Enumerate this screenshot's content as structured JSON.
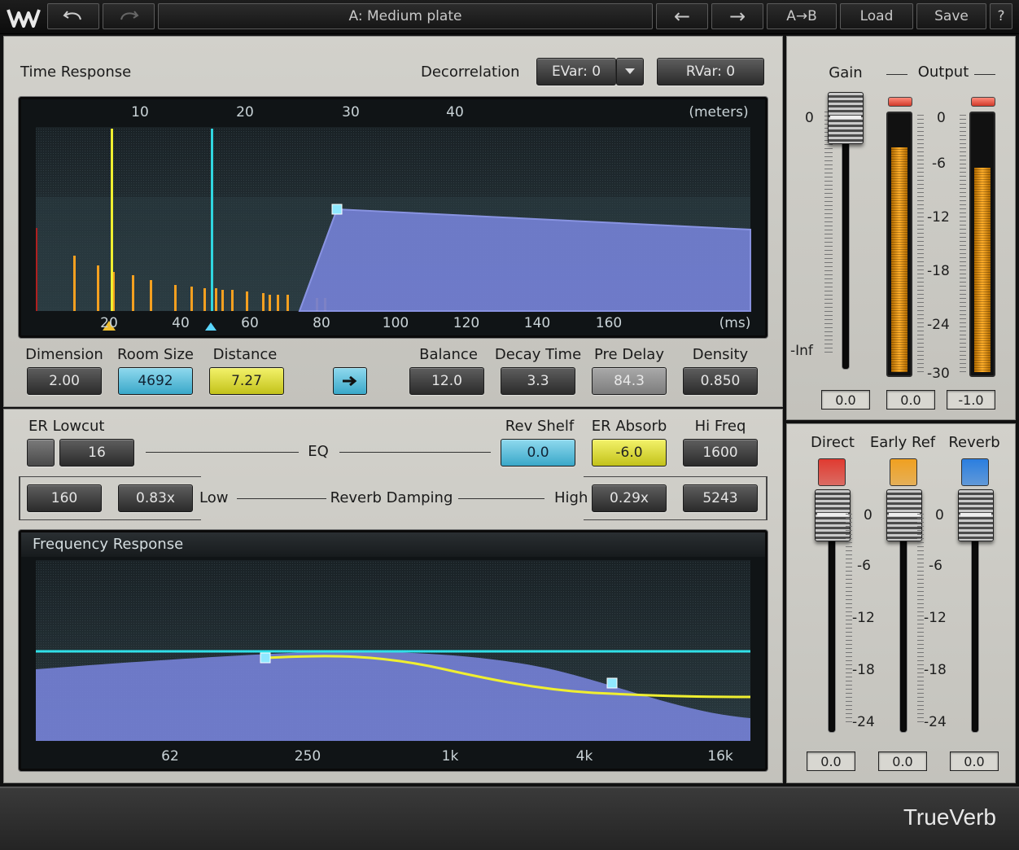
{
  "toolbar": {
    "preset": "A: Medium plate",
    "prev_label": "←",
    "next_label": "→",
    "ab_label": "A→B",
    "load_label": "Load",
    "save_label": "Save",
    "help_label": "?"
  },
  "time_response": {
    "title": "Time Response",
    "decorrelation_label": "Decorrelation",
    "evar": "EVar: 0",
    "rvar": "RVar: 0",
    "meters_ticks": [
      "10",
      "20",
      "30",
      "40"
    ],
    "meters_unit": "(meters)",
    "ms_ticks": [
      "20",
      "40",
      "60",
      "80",
      "100",
      "120",
      "140",
      "160"
    ],
    "ms_unit": "(ms)"
  },
  "params": {
    "dimension": {
      "label": "Dimension",
      "value": "2.00"
    },
    "room_size": {
      "label": "Room Size",
      "value": "4692"
    },
    "distance": {
      "label": "Distance",
      "value": "7.27"
    },
    "balance": {
      "label": "Balance",
      "value": "12.0"
    },
    "decay_time": {
      "label": "Decay Time",
      "value": "3.3"
    },
    "pre_delay": {
      "label": "Pre Delay",
      "value": "84.3"
    },
    "density": {
      "label": "Density",
      "value": "0.850"
    }
  },
  "eq": {
    "er_lowcut_label": "ER Lowcut",
    "er_lowcut_value": "16",
    "eq_label": "EQ",
    "rev_shelf_label": "Rev Shelf",
    "rev_shelf_value": "0.0",
    "er_absorb_label": "ER Absorb",
    "er_absorb_value": "-6.0",
    "hi_freq_label": "Hi Freq",
    "hi_freq_value": "1600",
    "damp_low_freq": "160",
    "damp_low_ratio": "0.83x",
    "low_label": "Low",
    "reverb_damping_label": "Reverb Damping",
    "high_label": "High",
    "damp_high_ratio": "0.29x",
    "damp_high_freq": "5243"
  },
  "freq_response": {
    "title": "Frequency Response",
    "ticks": [
      "62",
      "250",
      "1k",
      "4k",
      "16k"
    ]
  },
  "gain_output": {
    "gain_label": "Gain",
    "output_label": "Output",
    "gain_scale": [
      "0",
      "-Inf"
    ],
    "output_scale": [
      "0",
      "-6",
      "-12",
      "-18",
      "-24",
      "-30"
    ],
    "gain_value": "0.0",
    "out_left": "0.0",
    "out_right": "-1.0",
    "meter_left_level": 0.88,
    "meter_right_level": 0.8
  },
  "mix": {
    "direct_label": "Direct",
    "early_label": "Early Ref",
    "reverb_label": "Reverb",
    "scale": [
      "0",
      "-6",
      "-12",
      "-18",
      "-24"
    ],
    "direct_value": "0.0",
    "early_value": "0.0",
    "reverb_value": "0.0",
    "direct_color": "#e03a30",
    "early_color": "#f0a020",
    "reverb_color": "#2a7ee0"
  },
  "brand": "TrueVerb"
}
